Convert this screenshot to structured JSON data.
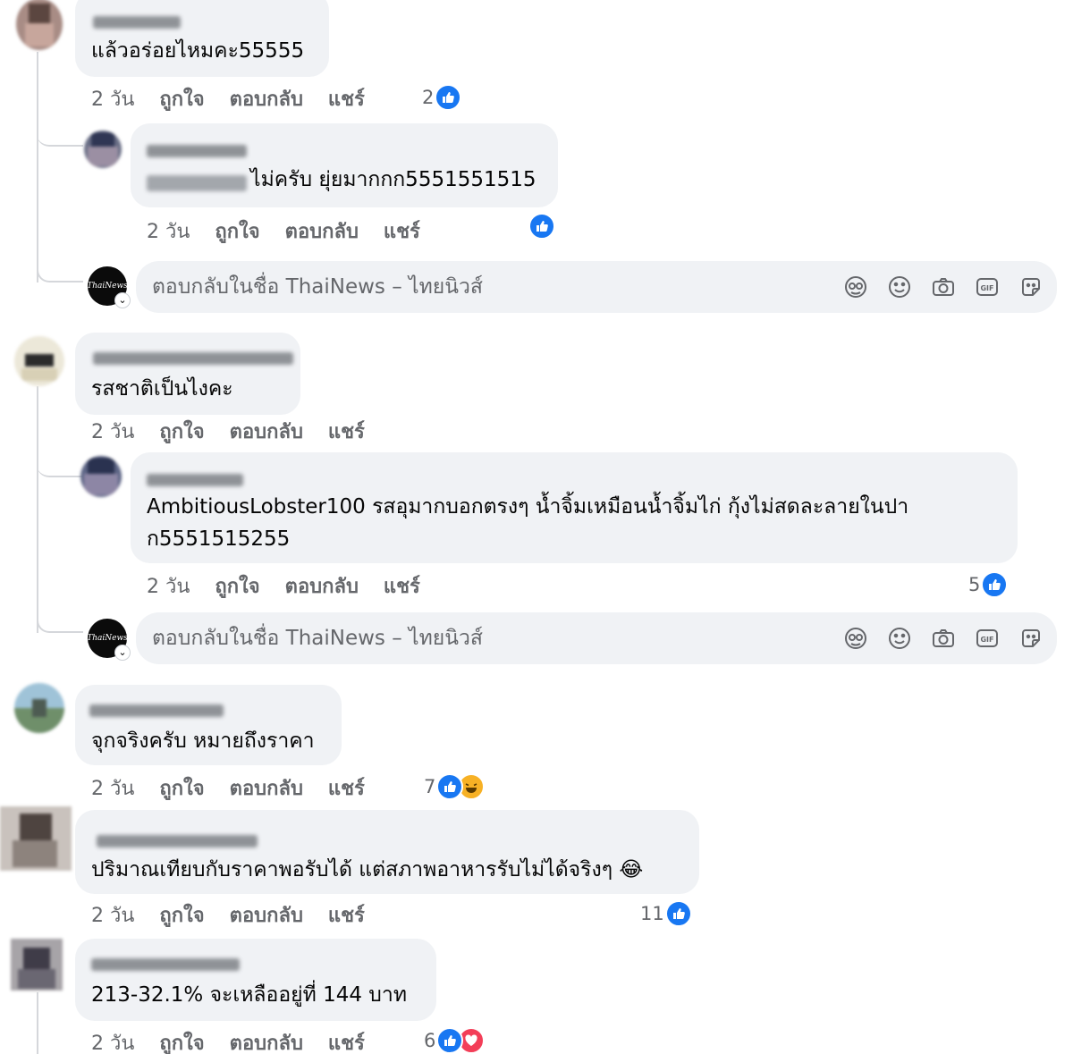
{
  "actions": {
    "time": "2 วัน",
    "like": "ถูกใจ",
    "reply": "ตอบกลับ",
    "share": "แชร์"
  },
  "composer": {
    "placeholder": "ตอบกลับในชื่อ ThaiNews – ไทยนิวส์",
    "avatar_text": "ThaiNews",
    "icons": [
      "avatar-sticker-icon",
      "emoji-icon",
      "camera-icon",
      "gif-icon",
      "sticker-icon"
    ]
  },
  "comments": [
    {
      "text": "แล้วอร่อยไหมคะ55555",
      "reactions": {
        "count": "2",
        "types": [
          "like"
        ]
      }
    },
    {
      "text": "ไม่ครับ ยุ่ยมากกก5551551515",
      "reactions": {
        "count": "",
        "types": [
          "like"
        ]
      }
    },
    {
      "text": "รสชาติเป็นไงคะ"
    },
    {
      "text_line1": "AmbitiousLobster100 รสอุมากบอกตรงๆ น้ำจิ้มเหมือนน้ำจิ้มไก่ กุ้งไม่สดละลายในปา",
      "text_line2": "ก5551515255",
      "reactions": {
        "count": "5",
        "types": [
          "like"
        ]
      }
    },
    {
      "text": "จุกจริงครับ หมายถึงราคา",
      "reactions": {
        "count": "7",
        "types": [
          "like",
          "haha"
        ]
      }
    },
    {
      "text": "ปริมาณเทียบกับราคาพอรับได้ แต่สภาพอาหารรับไม่ได้จริงๆ",
      "emoji": "😂",
      "reactions": {
        "count": "11",
        "types": [
          "like"
        ]
      }
    },
    {
      "text": "213-32.1% จะเหลืออยู่ที่ 144 บาท",
      "reactions": {
        "count": "6",
        "types": [
          "like",
          "love"
        ]
      }
    }
  ],
  "colors": {
    "bubble": "#f0f2f5",
    "secondary_text": "#65676b",
    "like_blue": "#1877f2",
    "haha_yellow": "#f7b125",
    "love_red": "#f33e58"
  }
}
